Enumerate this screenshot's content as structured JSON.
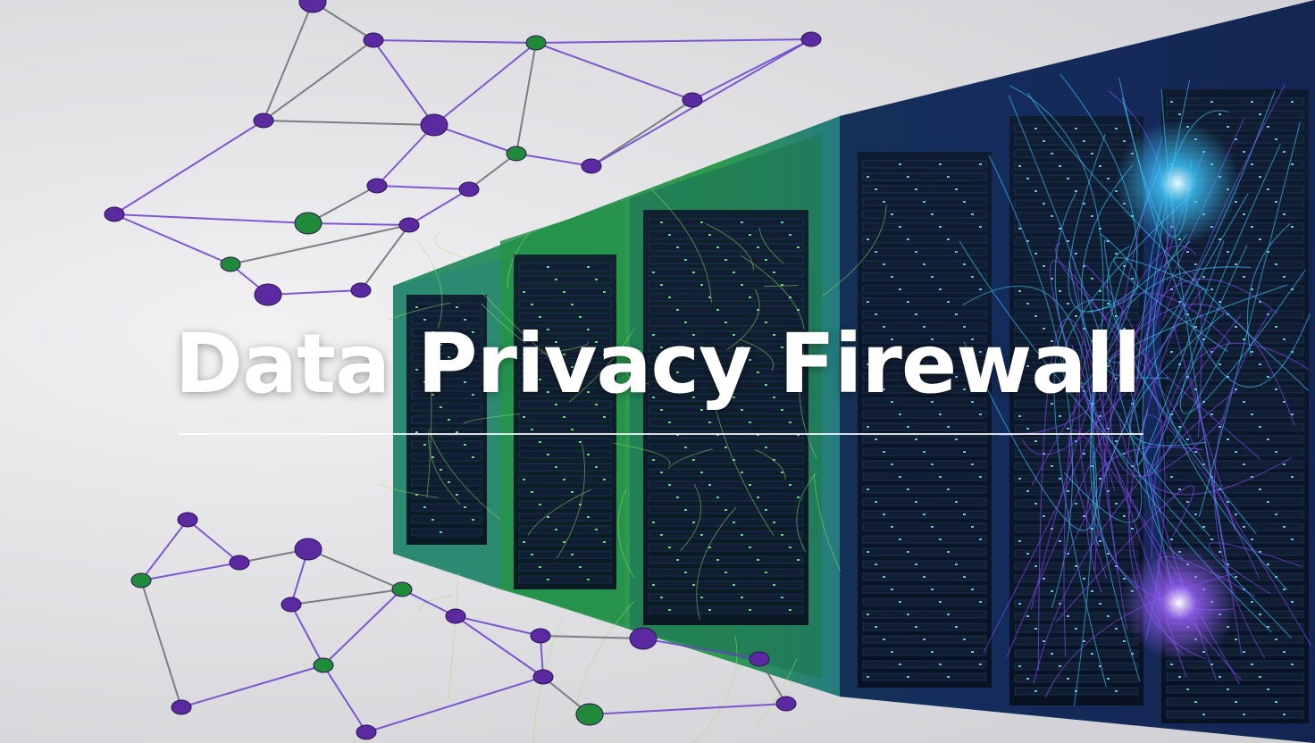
{
  "headline": "Data Privacy Firewall",
  "colors": {
    "node_purple": "#5b2aa0",
    "node_green": "#1f8a3a",
    "rack_blue": "#1d4fa8",
    "rack_green": "#3fae4a",
    "fiber_cyan": "#3ec8ff",
    "fiber_violet": "#8a4dff"
  },
  "illustration": {
    "subject": "server-racks-with-network-mesh"
  }
}
